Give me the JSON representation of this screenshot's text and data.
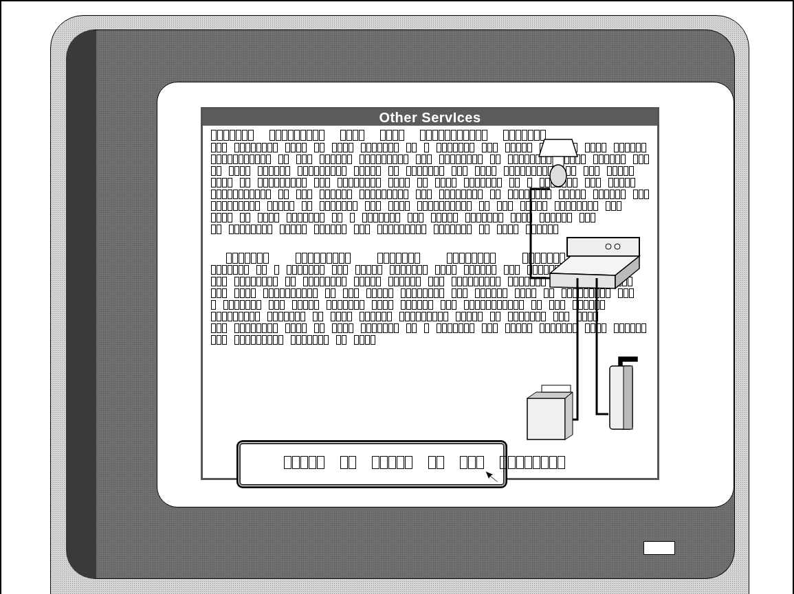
{
  "card": {
    "title": "Other ServIces"
  }
}
